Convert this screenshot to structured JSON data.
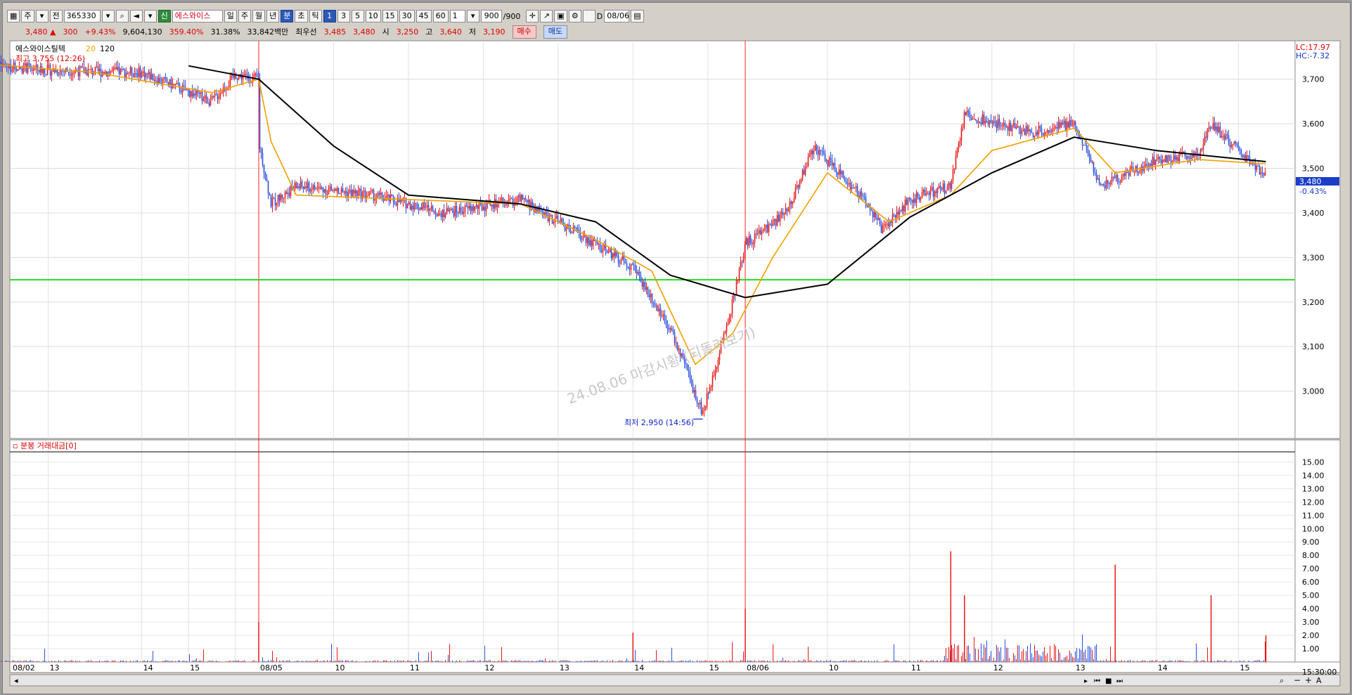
{
  "toolbar": {
    "market_label": "주",
    "type_label": "전",
    "code": "365330",
    "new_label": "신",
    "stock_name": "에스와이스",
    "period_buttons": [
      "일",
      "주",
      "월",
      "년",
      "분",
      "초",
      "틱"
    ],
    "interval_buttons": [
      "1",
      "3",
      "5",
      "10",
      "15",
      "30",
      "45",
      "60"
    ],
    "unit_value": "1",
    "count_value": "900",
    "count_total": "/900",
    "d_label": "D",
    "date_value": "08/06"
  },
  "infobar": {
    "price": "3,480",
    "change": "300",
    "change_pct": "+9.43%",
    "volume": "9,604,130",
    "volume_ratio": "359.40%",
    "turnover": "31.38%",
    "amount": "33,842백만",
    "best_bid_label": "최우선",
    "best_ask": "3,485",
    "best_bid": "3,480",
    "open_label": "시",
    "open": "3,250",
    "high_label": "고",
    "high": "3,640",
    "low_label": "저",
    "low": "3,190",
    "buy_label": "매수",
    "sell_label": "매도"
  },
  "price_panel": {
    "legend_name": "에스와이스틸텍",
    "ma20_label": "20",
    "ma120_label": "120",
    "max_marker": "최고 3,755 (12:26)",
    "min_marker": "최저 2,950 (14:56)",
    "lc_label": "LC:17.97",
    "hc_label": "HC:-7.32",
    "current_price_tag": "3,480",
    "current_pct_tag": "-0.43%",
    "watermark": "24.08.06 마감시황 (되돌려보기)",
    "y_ticks": [
      "3,700",
      "3,600",
      "3,500",
      "3,400",
      "3,300",
      "3,200",
      "3,100",
      "3,000"
    ]
  },
  "volume_panel": {
    "title": "분봉 거래대금[0]",
    "y_ticks": [
      "15.00",
      "14.00",
      "13.00",
      "12.00",
      "11.00",
      "10.00",
      "9.00",
      "8.00",
      "7.00",
      "6.00",
      "5.00",
      "4.00",
      "3.00",
      "2.00",
      "1.00"
    ]
  },
  "x_axis": {
    "labels": [
      "08/02",
      "13",
      "14",
      "15",
      "08/05",
      "10",
      "11",
      "12",
      "13",
      "14",
      "15",
      "08/06",
      "10",
      "11",
      "12",
      "13",
      "14",
      "15"
    ],
    "time_label": "15:30:00"
  },
  "colors": {
    "up": "#e81818",
    "down": "#2a50e0",
    "ma20": "#f0a000",
    "ma120": "#000000",
    "support_line": "#22dd22",
    "day_separator": "#ff2020"
  },
  "chart_data": {
    "type": "candlestick",
    "interval": "1-minute",
    "y_range": [
      2900,
      3780
    ],
    "support_level": 3250,
    "close_path": [
      {
        "t": "08/02 09:00",
        "v": 3740
      },
      {
        "t": "08/02 11:00",
        "v": 3720
      },
      {
        "t": "08/02 13:00",
        "v": 3715
      },
      {
        "t": "08/02 14:30",
        "v": 3650
      },
      {
        "t": "08/02 15:00",
        "v": 3710
      },
      {
        "t": "08/02 15:30",
        "v": 3700
      },
      {
        "t": "08/05 09:00",
        "v": 3560
      },
      {
        "t": "08/05 09:10",
        "v": 3420
      },
      {
        "t": "08/05 09:30",
        "v": 3460
      },
      {
        "t": "08/05 10:30",
        "v": 3440
      },
      {
        "t": "08/05 11:30",
        "v": 3400
      },
      {
        "t": "08/05 12:30",
        "v": 3430
      },
      {
        "t": "08/05 13:30",
        "v": 3330
      },
      {
        "t": "08/05 14:00",
        "v": 3280
      },
      {
        "t": "08/05 14:30",
        "v": 3140
      },
      {
        "t": "08/05 14:56",
        "v": 2950
      },
      {
        "t": "08/05 15:20",
        "v": 3200
      },
      {
        "t": "08/06 09:00",
        "v": 3330
      },
      {
        "t": "08/06 09:30",
        "v": 3400
      },
      {
        "t": "08/06 09:50",
        "v": 3550
      },
      {
        "t": "08/06 10:30",
        "v": 3420
      },
      {
        "t": "08/06 10:40",
        "v": 3360
      },
      {
        "t": "08/06 11:00",
        "v": 3430
      },
      {
        "t": "08/06 11:30",
        "v": 3460
      },
      {
        "t": "08/06 11:40",
        "v": 3620
      },
      {
        "t": "08/06 12:30",
        "v": 3580
      },
      {
        "t": "08/06 13:00",
        "v": 3600
      },
      {
        "t": "08/06 13:20",
        "v": 3460
      },
      {
        "t": "08/06 14:00",
        "v": 3520
      },
      {
        "t": "08/06 14:30",
        "v": 3530
      },
      {
        "t": "08/06 14:40",
        "v": 3600
      },
      {
        "t": "08/06 15:20",
        "v": 3480
      }
    ],
    "ma20_path": [
      {
        "t": "08/02 09:00",
        "v": 3740
      },
      {
        "t": "08/02 12:00",
        "v": 3715
      },
      {
        "t": "08/02 14:30",
        "v": 3670
      },
      {
        "t": "08/02 15:30",
        "v": 3700
      },
      {
        "t": "08/05 09:10",
        "v": 3560
      },
      {
        "t": "08/05 09:30",
        "v": 3440
      },
      {
        "t": "08/05 11:00",
        "v": 3430
      },
      {
        "t": "08/05 12:30",
        "v": 3420
      },
      {
        "t": "08/05 13:30",
        "v": 3340
      },
      {
        "t": "08/05 14:15",
        "v": 3270
      },
      {
        "t": "08/05 14:50",
        "v": 3060
      },
      {
        "t": "08/05 15:20",
        "v": 3130
      },
      {
        "t": "08/06 09:20",
        "v": 3300
      },
      {
        "t": "08/06 10:00",
        "v": 3490
      },
      {
        "t": "08/06 10:45",
        "v": 3380
      },
      {
        "t": "08/06 11:30",
        "v": 3440
      },
      {
        "t": "08/06 12:00",
        "v": 3540
      },
      {
        "t": "08/06 13:00",
        "v": 3590
      },
      {
        "t": "08/06 13:30",
        "v": 3490
      },
      {
        "t": "08/06 14:30",
        "v": 3520
      },
      {
        "t": "08/06 15:20",
        "v": 3510
      }
    ],
    "ma120_path": [
      {
        "t": "08/02 14:00",
        "v": 3730
      },
      {
        "t": "08/02 15:30",
        "v": 3700
      },
      {
        "t": "08/05 10:00",
        "v": 3550
      },
      {
        "t": "08/05 11:00",
        "v": 3440
      },
      {
        "t": "08/05 12:30",
        "v": 3420
      },
      {
        "t": "08/05 13:30",
        "v": 3380
      },
      {
        "t": "08/05 14:30",
        "v": 3260
      },
      {
        "t": "08/06 09:00",
        "v": 3210
      },
      {
        "t": "08/06 10:00",
        "v": 3240
      },
      {
        "t": "08/06 11:00",
        "v": 3390
      },
      {
        "t": "08/06 12:00",
        "v": 3490
      },
      {
        "t": "08/06 13:00",
        "v": 3570
      },
      {
        "t": "08/06 14:00",
        "v": 3540
      },
      {
        "t": "08/06 15:20",
        "v": 3515
      }
    ],
    "volume_spikes": [
      {
        "t": "08/05 09:00",
        "v": 3.0
      },
      {
        "t": "08/05 14:00",
        "v": 2.2
      },
      {
        "t": "08/06 09:00",
        "v": 4.0
      },
      {
        "t": "08/06 11:30",
        "v": 8.3
      },
      {
        "t": "08/06 11:40",
        "v": 5.0
      },
      {
        "t": "08/06 13:30",
        "v": 7.3
      },
      {
        "t": "08/06 14:40",
        "v": 5.0
      },
      {
        "t": "08/06 15:20",
        "v": 2.0
      }
    ]
  }
}
